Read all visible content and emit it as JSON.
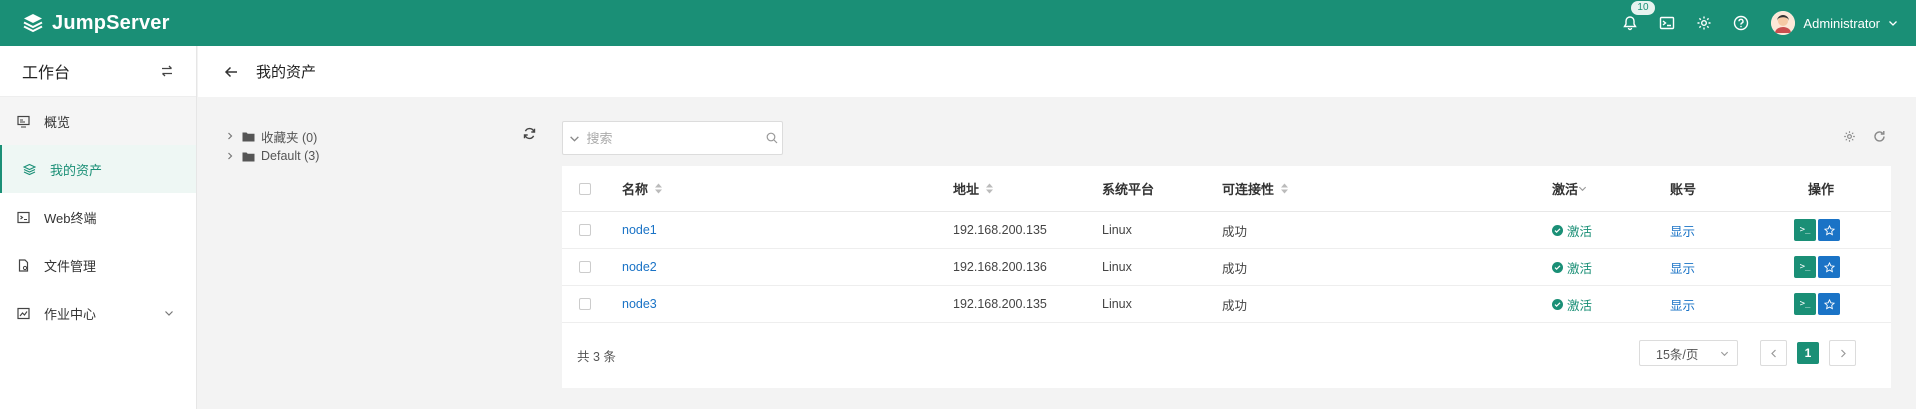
{
  "app": {
    "logo_text": "JumpServer"
  },
  "topbar": {
    "notification_count": "10",
    "user_name": "Administrator"
  },
  "sidebar": {
    "title": "工作台",
    "items": [
      {
        "label": "概览",
        "icon": "monitor-icon"
      },
      {
        "label": "我的资产",
        "icon": "layers-icon"
      },
      {
        "label": "Web终端",
        "icon": "terminal-icon"
      },
      {
        "label": "文件管理",
        "icon": "file-icon"
      },
      {
        "label": "作业中心",
        "icon": "job-icon"
      }
    ]
  },
  "page": {
    "title": "我的资产"
  },
  "tree": {
    "nodes": [
      {
        "label": "收藏夹 (0)"
      },
      {
        "label": "Default (3)"
      }
    ]
  },
  "search": {
    "placeholder": "搜索",
    "value": ""
  },
  "table": {
    "columns": {
      "name": "名称",
      "address": "地址",
      "platform": "系统平台",
      "connectivity": "可连接性",
      "active": "激活",
      "account": "账号",
      "actions": "操作"
    },
    "rows": [
      {
        "name": "node1",
        "address": "192.168.200.135",
        "platform": "Linux",
        "connectivity": "成功",
        "active": "激活",
        "account": "显示"
      },
      {
        "name": "node2",
        "address": "192.168.200.136",
        "platform": "Linux",
        "connectivity": "成功",
        "active": "激活",
        "account": "显示"
      },
      {
        "name": "node3",
        "address": "192.168.200.135",
        "platform": "Linux",
        "connectivity": "成功",
        "active": "激活",
        "account": "显示"
      }
    ]
  },
  "pagination": {
    "total": "共 3 条",
    "page_size": "15条/页",
    "current_page": "1"
  },
  "colors": {
    "brand": "#1a8f76",
    "link": "#1a73c6"
  }
}
